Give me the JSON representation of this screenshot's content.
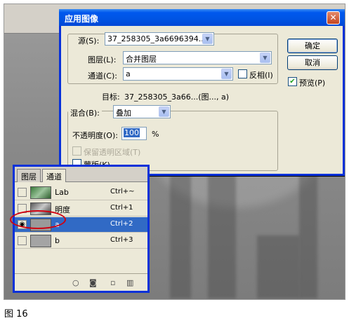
{
  "dialog": {
    "title": "应用图像",
    "source_label": "源(S):",
    "source_value": "37_258305_3a6696394...",
    "layer_label": "图层(L):",
    "layer_value": "合并图层",
    "channel_label": "通道(C):",
    "channel_value": "a",
    "invert_label": "反相(I)",
    "target_label": "目标:",
    "target_value": "37_258305_3a66...(图..., a)",
    "blend_label": "混合(B):",
    "blend_value": "叠加",
    "opacity_label": "不透明度(O):",
    "opacity_value": "100",
    "opacity_unit": "%",
    "preserve_label": "保留透明区域(T)",
    "mask_label": "蒙版(K)...",
    "ok_label": "确定",
    "cancel_label": "取消",
    "preview_label": "预览(P)",
    "preview_checked": true,
    "close_glyph": "✕"
  },
  "channels_panel": {
    "tabs": [
      "图层",
      "通道"
    ],
    "rows": [
      {
        "name": "Lab",
        "shortcut": "Ctrl+~",
        "visible": false,
        "selected": false
      },
      {
        "name": "明度",
        "shortcut": "Ctrl+1",
        "visible": false,
        "selected": false
      },
      {
        "name": "a",
        "shortcut": "Ctrl+2",
        "visible": true,
        "selected": true
      },
      {
        "name": "b",
        "shortcut": "Ctrl+3",
        "visible": false,
        "selected": false
      }
    ],
    "footer_icons": [
      "load-selection-icon",
      "save-selection-icon",
      "new-channel-icon",
      "delete-channel-icon"
    ]
  },
  "caption": "图 16",
  "colors": {
    "title_blue": "#0054e3",
    "selection_blue": "#316ac5",
    "dialog_bg": "#ece9d8",
    "highlight_red": "#d00010"
  }
}
